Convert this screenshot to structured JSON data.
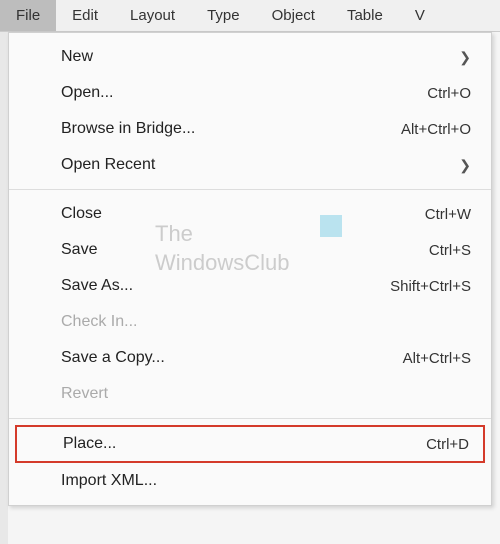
{
  "menubar": {
    "items": [
      {
        "label": "File",
        "active": true
      },
      {
        "label": "Edit",
        "active": false
      },
      {
        "label": "Layout",
        "active": false
      },
      {
        "label": "Type",
        "active": false
      },
      {
        "label": "Object",
        "active": false
      },
      {
        "label": "Table",
        "active": false
      },
      {
        "label": "V",
        "active": false
      }
    ]
  },
  "dropdown": {
    "groups": [
      [
        {
          "label": "New",
          "shortcut": "",
          "submenu": true,
          "disabled": false,
          "highlighted": false
        },
        {
          "label": "Open...",
          "shortcut": "Ctrl+O",
          "submenu": false,
          "disabled": false,
          "highlighted": false
        },
        {
          "label": "Browse in Bridge...",
          "shortcut": "Alt+Ctrl+O",
          "submenu": false,
          "disabled": false,
          "highlighted": false
        },
        {
          "label": "Open Recent",
          "shortcut": "",
          "submenu": true,
          "disabled": false,
          "highlighted": false
        }
      ],
      [
        {
          "label": "Close",
          "shortcut": "Ctrl+W",
          "submenu": false,
          "disabled": false,
          "highlighted": false
        },
        {
          "label": "Save",
          "shortcut": "Ctrl+S",
          "submenu": false,
          "disabled": false,
          "highlighted": false
        },
        {
          "label": "Save As...",
          "shortcut": "Shift+Ctrl+S",
          "submenu": false,
          "disabled": false,
          "highlighted": false
        },
        {
          "label": "Check In...",
          "shortcut": "",
          "submenu": false,
          "disabled": true,
          "highlighted": false
        },
        {
          "label": "Save a Copy...",
          "shortcut": "Alt+Ctrl+S",
          "submenu": false,
          "disabled": false,
          "highlighted": false
        },
        {
          "label": "Revert",
          "shortcut": "",
          "submenu": false,
          "disabled": true,
          "highlighted": false
        }
      ],
      [
        {
          "label": "Place...",
          "shortcut": "Ctrl+D",
          "submenu": false,
          "disabled": false,
          "highlighted": true
        },
        {
          "label": "Import XML...",
          "shortcut": "",
          "submenu": false,
          "disabled": false,
          "highlighted": false
        }
      ]
    ]
  },
  "watermark": {
    "line1": "The",
    "line2": "WindowsClub"
  }
}
